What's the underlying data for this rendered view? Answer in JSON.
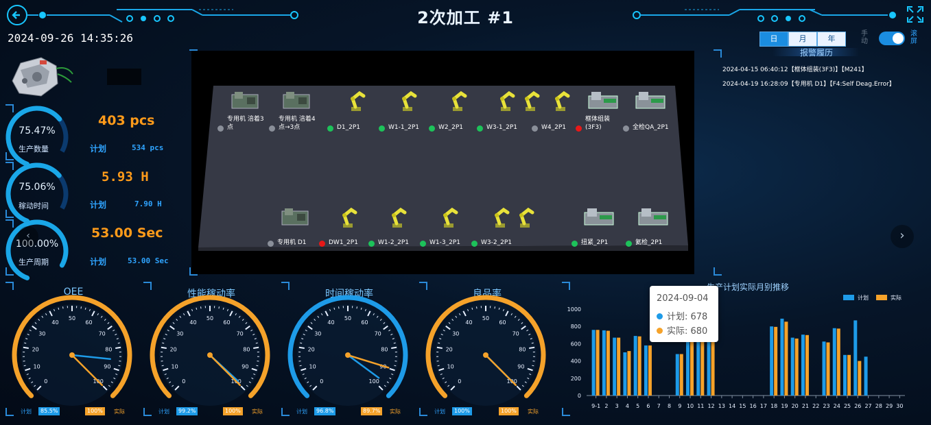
{
  "header": {
    "title": "2次加工 #1",
    "datetime": "2024-09-26 14:35:26",
    "period_tabs": [
      "日",
      "月",
      "年"
    ],
    "manual_label": "手\n动",
    "scroll_label": "滚\n屏"
  },
  "kpis": [
    {
      "percent": "75.47%",
      "label": "生产数量",
      "actual": "403 pcs",
      "plan_label": "计划",
      "plan_value": "534 pcs",
      "fill": 0.7547
    },
    {
      "percent": "75.06%",
      "label": "稼动时间",
      "actual": "5.93 H",
      "plan_label": "计划",
      "plan_value": "7.90 H",
      "fill": 0.7506
    },
    {
      "percent": "100.00%",
      "label": "生产周期",
      "actual": "53.00 Sec",
      "plan_label": "计划",
      "plan_value": "53.00 Sec",
      "fill": 1.0
    }
  ],
  "alarms": {
    "title": "报警履历",
    "items": [
      "2024-04-15 06:40:12【框体组装(3F3)】【M241】",
      "2024-04-19 16:28:09【专用机 D1】【F4:Self Deag.Error】"
    ]
  },
  "stations_top": [
    {
      "name": "专用机 涪着3\n点",
      "status": "gray"
    },
    {
      "name": "专用机 涪着4\n点→3点",
      "status": "gray"
    },
    {
      "name": "D1_2P1",
      "status": "green"
    },
    {
      "name": "W1-1_2P1",
      "status": "green"
    },
    {
      "name": "W2_2P1",
      "status": "green"
    },
    {
      "name": "W3-1_2P1",
      "status": "green"
    },
    {
      "name": "W4_2P1",
      "status": "gray"
    },
    {
      "name": "框体组装\n(3F3)",
      "status": "red"
    },
    {
      "name": "全检QA_2P1",
      "status": "gray"
    }
  ],
  "stations_bottom": [
    {
      "name": "专用机 D1",
      "status": "gray"
    },
    {
      "name": "DW1_2P1",
      "status": "red"
    },
    {
      "name": "W1-2_2P1",
      "status": "green"
    },
    {
      "name": "W1-3_2P1",
      "status": "green"
    },
    {
      "name": "W3-2_2P1",
      "status": "green"
    },
    {
      "name": "扭紧_2P1",
      "status": "green"
    },
    {
      "name": "氦检_2P1",
      "status": "green"
    }
  ],
  "colors": {
    "accent": "#1aa7e8",
    "orange": "#ff9b1a",
    "plan": "#1e9be8",
    "actual": "#f5a22a",
    "green": "#1dc25a",
    "red": "#e81818",
    "gray": "#8a8f99"
  },
  "gauges": [
    {
      "title": "OEE",
      "plan_label": "计划",
      "plan_value": "85.5%",
      "actual_value": "100%",
      "actual_label": "实际",
      "needle_plan": 85.5,
      "needle_actual": 100,
      "ring": "orange"
    },
    {
      "title": "性能稼动率",
      "plan_label": "计划",
      "plan_value": "99.2%",
      "actual_value": "100%",
      "actual_label": "实际",
      "needle_plan": 99.2,
      "needle_actual": 100,
      "ring": "orange"
    },
    {
      "title": "时间稼动率",
      "plan_label": "计划",
      "plan_value": "96.8%",
      "actual_value": "89.7%",
      "actual_label": "实际",
      "needle_plan": 96.8,
      "needle_actual": 89.7,
      "ring": "blue"
    },
    {
      "title": "良品率",
      "plan_label": "计划",
      "plan_value": "100%",
      "actual_value": "100%",
      "actual_label": "实际",
      "needle_plan": 100,
      "needle_actual": 100,
      "ring": "orange"
    }
  ],
  "gauge_ticks": [
    "0",
    "10",
    "20",
    "30",
    "40",
    "50",
    "60",
    "70",
    "80",
    "90",
    "100"
  ],
  "chart_data": {
    "type": "bar",
    "title": "生产计划实际月别推移",
    "legend": [
      "计划",
      "实际"
    ],
    "legend_position": "top-right",
    "categories": [
      "9-1",
      "2",
      "3",
      "4",
      "5",
      "6",
      "7",
      "8",
      "9",
      "10",
      "11",
      "12",
      "13",
      "14",
      "15",
      "16",
      "17",
      "18",
      "19",
      "20",
      "21",
      "22",
      "23",
      "24",
      "25",
      "26",
      "27",
      "28",
      "29",
      "30"
    ],
    "series": [
      {
        "name": "计划",
        "values": [
          760,
          755,
          670,
          500,
          690,
          580,
          0,
          0,
          480,
          650,
          680,
          650,
          0,
          0,
          0,
          0,
          0,
          800,
          890,
          670,
          705,
          0,
          625,
          780,
          470,
          870,
          450,
          0,
          0,
          0
        ]
      },
      {
        "name": "实际",
        "values": [
          760,
          750,
          670,
          515,
          685,
          580,
          0,
          0,
          480,
          640,
          680,
          710,
          0,
          0,
          0,
          0,
          0,
          795,
          855,
          660,
          700,
          0,
          615,
          775,
          470,
          400,
          0,
          0,
          0,
          0
        ]
      }
    ],
    "ylim": [
      0,
      1000
    ],
    "yticks": [
      "0",
      "200",
      "400",
      "600",
      "800",
      "1000"
    ],
    "tooltip": {
      "date": "2024-09-04",
      "plan": "计划: 678",
      "actual": "实际: 680"
    }
  }
}
